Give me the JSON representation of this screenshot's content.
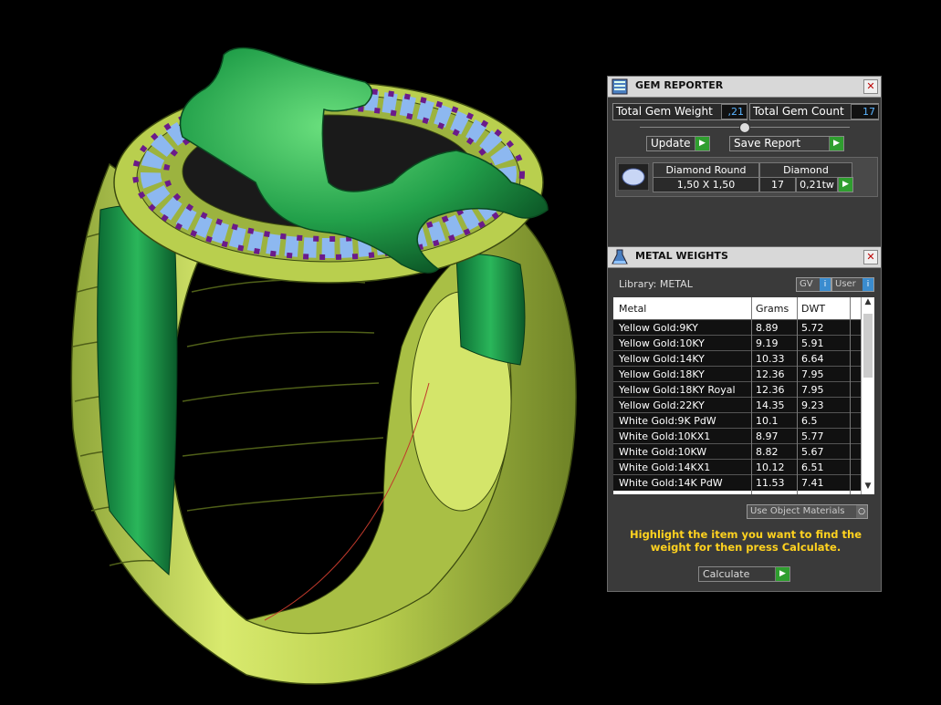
{
  "gem_reporter": {
    "title": "GEM REPORTER",
    "total_weight_label": "Total Gem Weight",
    "total_weight_value": ",21",
    "total_count_label": "Total Gem Count",
    "total_count_value": "17",
    "update_label": "Update",
    "save_report_label": "Save Report",
    "gem_table": {
      "headers": [
        "Diamond Round",
        "Diamond"
      ],
      "row": {
        "size": "1,50 X 1,50",
        "count": "17",
        "weight": "0,21tw"
      }
    }
  },
  "metal_weights": {
    "title": "METAL WEIGHTS",
    "library_label": "Library: METAL",
    "gv_label": "GV",
    "user_label": "User",
    "columns": [
      "Metal",
      "Grams",
      "DWT"
    ],
    "rows": [
      {
        "metal": "Yellow Gold:9KY",
        "grams": "8.89",
        "dwt": "5.72"
      },
      {
        "metal": "Yellow Gold:10KY",
        "grams": "9.19",
        "dwt": "5.91"
      },
      {
        "metal": "Yellow Gold:14KY",
        "grams": "10.33",
        "dwt": "6.64"
      },
      {
        "metal": "Yellow Gold:18KY",
        "grams": "12.36",
        "dwt": "7.95"
      },
      {
        "metal": "Yellow Gold:18KY Royal",
        "grams": "12.36",
        "dwt": "7.95"
      },
      {
        "metal": "Yellow Gold:22KY",
        "grams": "14.35",
        "dwt": "9.23"
      },
      {
        "metal": "White Gold:9K PdW",
        "grams": "10.1",
        "dwt": "6.5"
      },
      {
        "metal": "White Gold:10KX1",
        "grams": "8.97",
        "dwt": "5.77"
      },
      {
        "metal": "White Gold:10KW",
        "grams": "8.82",
        "dwt": "5.67"
      },
      {
        "metal": "White Gold:14KX1",
        "grams": "10.12",
        "dwt": "6.51"
      },
      {
        "metal": "White Gold:14K PdW",
        "grams": "11.53",
        "dwt": "7.41"
      }
    ],
    "use_object_materials_label": "Use Object Materials",
    "hint": "Highlight the item you want to find the weight for then press Calculate.",
    "calculate_label": "Calculate"
  },
  "colors": {
    "metal_yellow": "#c9dc5a",
    "gem_green": "#1f9a4a",
    "diamond_blue": "#8db8f0",
    "amethyst": "#6b1a8a",
    "hint_yellow": "#ffd21f"
  }
}
